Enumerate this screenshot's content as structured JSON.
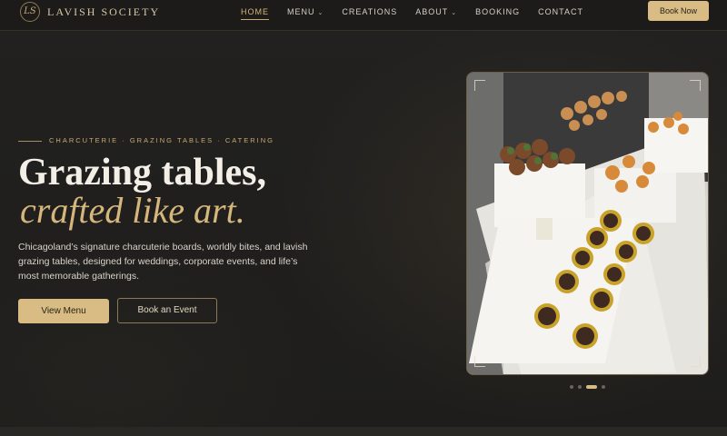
{
  "brand": {
    "name": "LAVISH SOCIETY",
    "monogram": "LS"
  },
  "nav": {
    "links": [
      {
        "label": "HOME",
        "active": true
      },
      {
        "label": "MENU",
        "dropdown": true
      },
      {
        "label": "CREATIONS"
      },
      {
        "label": "ABOUT",
        "dropdown": true
      },
      {
        "label": "BOOKING"
      },
      {
        "label": "CONTACT"
      }
    ],
    "cta": "Book Now"
  },
  "hero": {
    "eyebrow": "CHARCUTERIE · GRAZING TABLES · CATERING",
    "headline_line1": "Grazing tables,",
    "headline_line2": "crafted like art.",
    "description": "Chicagoland’s signature charcuterie boards, worldly bites, and lavish grazing tables, designed for weddings, corporate events, and life’s most memorable gatherings.",
    "primary_button": "View Menu",
    "secondary_button": "Book an Event"
  },
  "carousel": {
    "slides": 4,
    "active_index": 2
  },
  "colors": {
    "accent": "#d8bc83",
    "background": "#1f1e1c",
    "text": "#e8e4dc"
  }
}
